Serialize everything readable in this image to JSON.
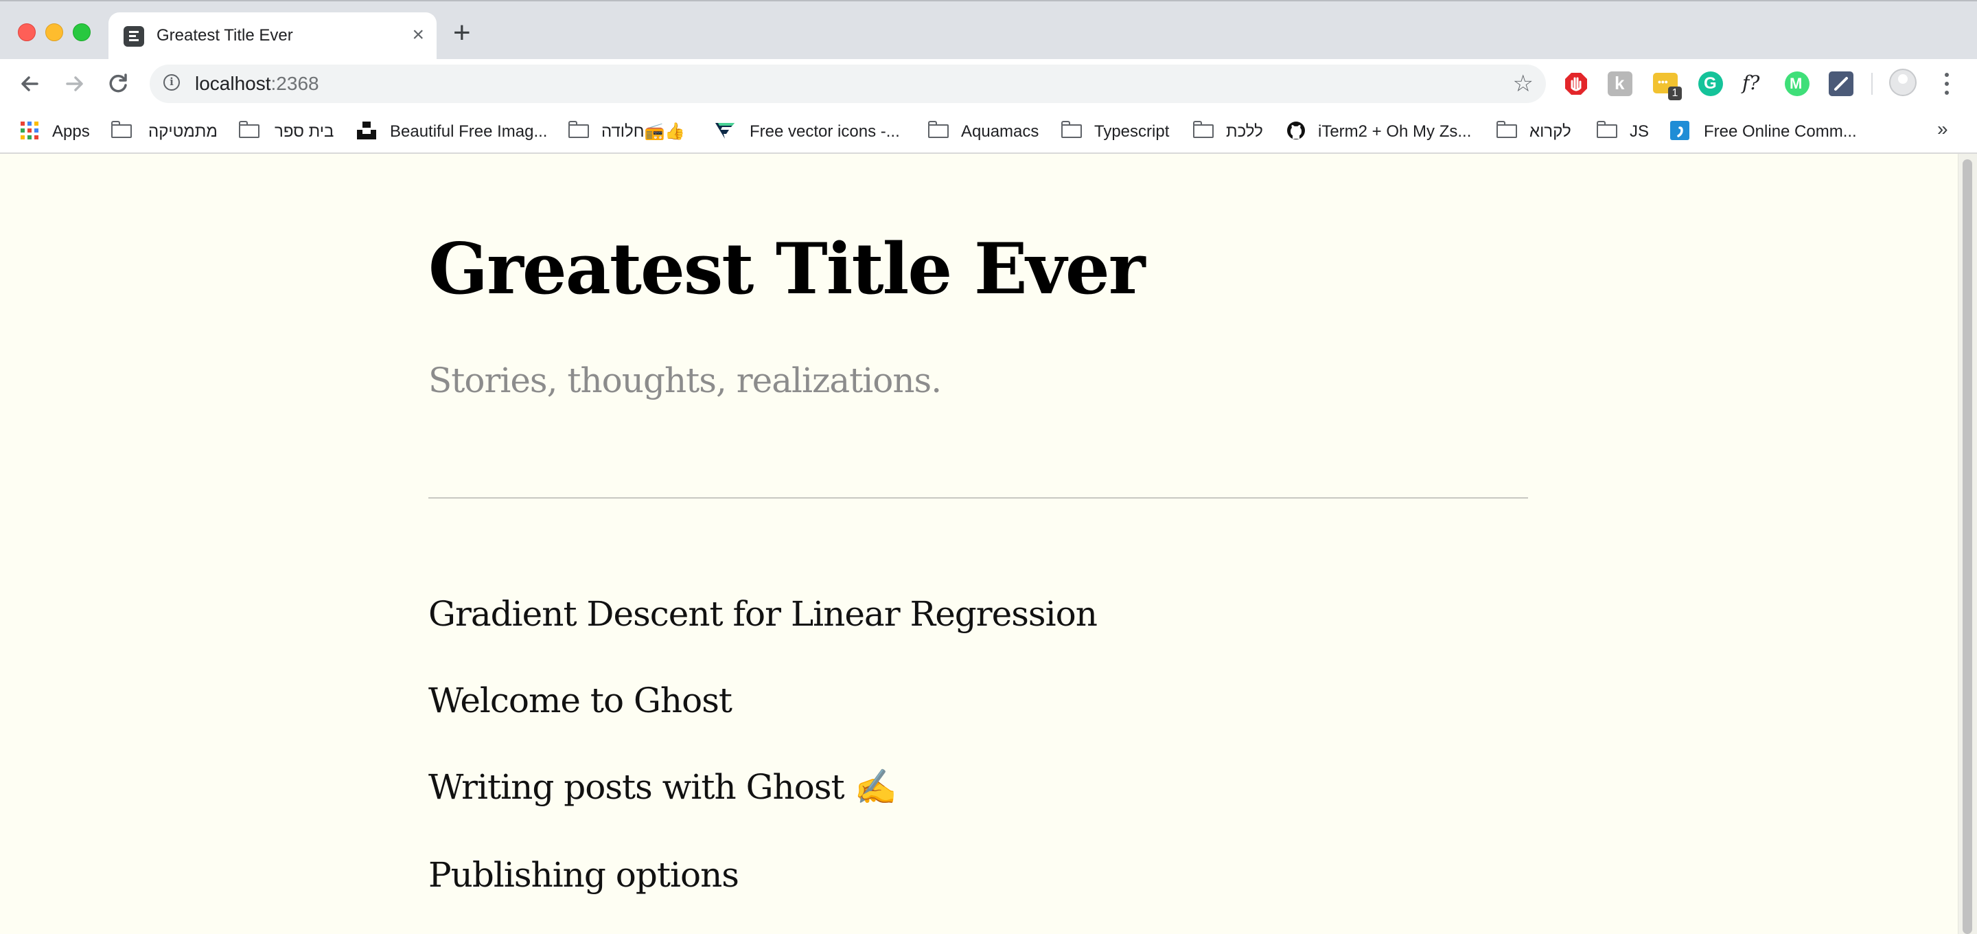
{
  "browser": {
    "tab": {
      "title": "Greatest Title Ever",
      "close_glyph": "×"
    },
    "new_tab_glyph": "+",
    "address": {
      "host": "localhost",
      "port": ":2368",
      "info_glyph": "i",
      "star_glyph": "☆"
    },
    "extensions": [
      "adblock-icon",
      "hacker-news-icon",
      "rss-notifier-icon",
      "grammarly-icon",
      "font-finder-icon",
      "mercury-icon",
      "editor-icon"
    ],
    "extension_badge": "1",
    "font_finder_glyph": "f?",
    "mercury_glyph": "M",
    "grammarly_glyph": "G",
    "hacker_glyph": "k",
    "overflow_glyph": "»"
  },
  "bookmarks": [
    {
      "label": "Apps",
      "icon": "apps-grid-icon"
    },
    {
      "label": "מתמטיקה",
      "icon": "folder-icon"
    },
    {
      "label": "בית ספר",
      "icon": "folder-icon"
    },
    {
      "label": "Beautiful Free Imag...",
      "icon": "unsplash-icon"
    },
    {
      "label": "חלודה📻👍",
      "icon": "folder-icon"
    },
    {
      "label": "Free vector icons -...",
      "icon": "flaticon-icon"
    },
    {
      "label": "Aquamacs",
      "icon": "folder-icon"
    },
    {
      "label": "Typescript",
      "icon": "folder-icon"
    },
    {
      "label": "ללכת",
      "icon": "folder-icon"
    },
    {
      "label": "iTerm2 + Oh My Zs...",
      "icon": "github-icon"
    },
    {
      "label": "לקרוא",
      "icon": "folder-icon"
    },
    {
      "label": "JS",
      "icon": "folder-icon"
    },
    {
      "label": "Free Online Comm...",
      "icon": "comma-icon"
    }
  ],
  "blog": {
    "title": "Greatest Title Ever",
    "description": "Stories, thoughts, realizations.",
    "posts": [
      "Gradient Descent for Linear Regression",
      "Welcome to Ghost",
      "Writing posts with Ghost ✍️",
      "Publishing options"
    ]
  },
  "colors": {
    "page_background": "#fefef3",
    "tabstrip": "#dee1e6",
    "omnibox": "#f1f3f4",
    "description_gray": "#8c8c8c"
  }
}
